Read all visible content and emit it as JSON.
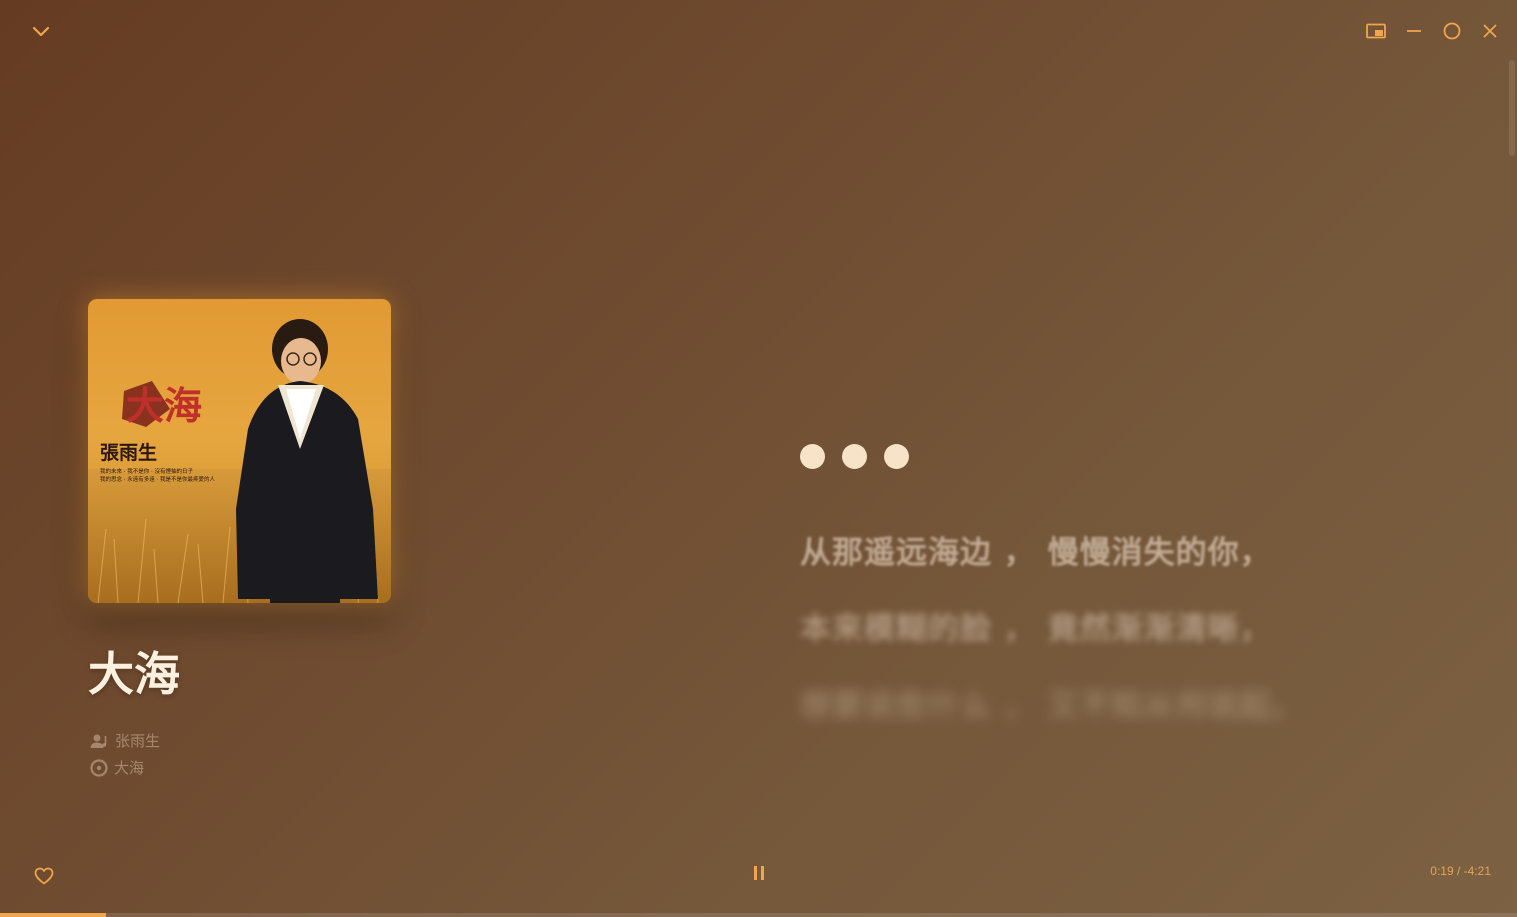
{
  "window": {
    "collapse_icon": "chevron-down-icon",
    "controls": [
      "mini-player-icon",
      "minimize-icon",
      "maximize-icon",
      "close-icon"
    ]
  },
  "song": {
    "title": "大海",
    "artist": "张雨生",
    "album": "大海"
  },
  "cover_art": {
    "text_title": "大海",
    "text_artist": "張雨生",
    "text_tracks_1": "我的未來 · 我不是你 · 沒有煙抽的日子",
    "text_tracks_2": "我的思念 · 永遠有多遠 · 我是不是你最疼愛的人"
  },
  "lyrics": {
    "loading": true,
    "lines": [
      "从那遥远海边 ， 慢慢消失的你，",
      "本来模糊的脸 ， 竟然渐渐清晰，",
      "想要说些什么 ， 又不知从何说起，"
    ]
  },
  "player": {
    "liked": false,
    "state": "playing",
    "time": "0:19 / -4:21",
    "progress": 0.07
  },
  "colors": {
    "accent": "#f1a54c",
    "dots": "#f7e3c8"
  }
}
